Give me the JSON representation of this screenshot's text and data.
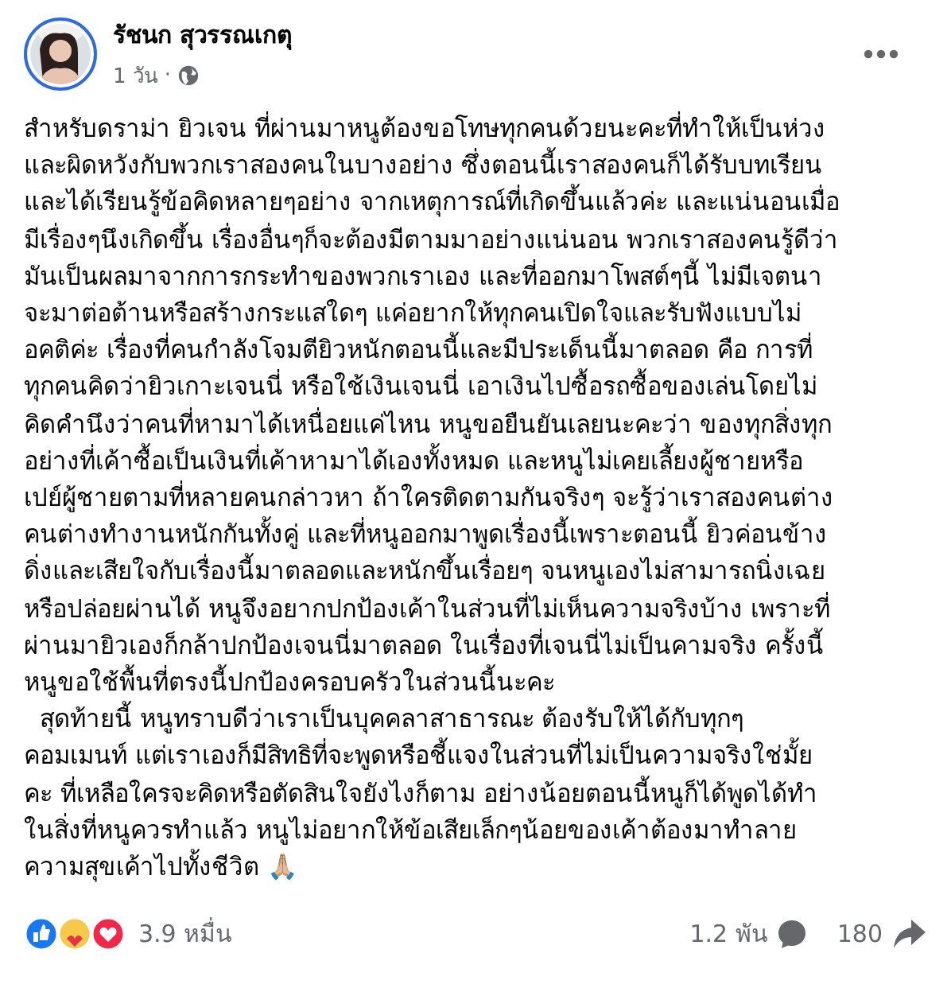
{
  "post": {
    "author": "รัชนก สุวรรณเกตุ",
    "time": "1 วัน",
    "separator": "·",
    "paragraphs": [
      {
        "lines": [
          "สำหรับดราม่า ยิวเจน ที่ผ่านมาหนูต้องขอโทษทุกคนด้วยนะคะที่ทำให้เป็นห่วง",
          "และผิดหวังกับพวกเราสองคนในบางอย่าง ซึ่งตอนนี้เราสองคนก็ได้รับบทเรียน",
          "และได้เรียนรู้ข้อคิดหลายๆอย่าง จากเหตุการณ์ที่เกิดขึ้นแล้วค่ะ และแน่นอนเมื่อ",
          "มีเรื่องๆนึงเกิดขึ้น เรื่องอื่นๆก็จะต้องมีตามมาอย่างแน่นอน พวกเราสองคนรู้ดีว่า",
          "มันเป็นผลมาจากการกระทำของพวกเราเอง และที่ออกมาโพสต์ๆนี้ ไม่มีเจตนา",
          "จะมาต่อต้านหรือสร้างกระแสใดๆ แค่อยากให้ทุกคนเปิดใจและรับฟังแบบไม่",
          "อคติค่ะ เรื่องที่คนกำลังโจมตียิวหนักตอนนี้และมีประเด็นนี้มาตลอด คือ การที่",
          "ทุกคนคิดว่ายิวเกาะเจนนี่ หรือใช้เงินเจนนี่ เอาเงินไปซื้อรถซื้อของเล่นโดยไม่",
          "คิดคำนึงว่าคนที่หามาได้เหนื่อยแค่ไหน หนูขอยืนยันเลยนะคะว่า ของทุกสิ่งทุก",
          "อย่างที่เค้าซื้อเป็นเงินที่เค้าหามาได้เองทั้งหมด และหนูไม่เคยเลี้ยงผู้ชายหรือ",
          "เปย์ผู้ชายตามที่หลายคนกล่าวหา ถ้าใครติดตามกันจริงๆ จะรู้ว่าเราสองคนต่าง",
          "คนต่างทำงานหนักกันทั้งคู่ และที่หนูออกมาพูดเรื่องนี้เพราะตอนนี้ ยิวค่อนข้าง",
          "ดิ่งและเสียใจกับเรื่องนี้มาตลอดและหนักขึ้นเรื่อยๆ จนหนูเองไม่สามารถนิ่งเฉย",
          "หรือปล่อยผ่านได้ หนูจึงอยากปกป้องเค้าในส่วนที่ไม่เห็นความจริงบ้าง เพราะที่",
          "ผ่านมายิวเองก็กล้าปกป้องเจนนี่มาตลอด ในเรื่องที่เจนนี่ไม่เป็นคามจริง ครั้งนี้",
          "หนูขอใช้พื้นที่ตรงนี้ปกป้องครอบครัวในส่วนนี้นะคะ"
        ]
      },
      {
        "lines": [
          "  สุดท้ายนี้ หนูทราบดีว่าเราเป็นบุคคลาสาธารณะ ต้องรับให้ได้กับทุกๆ",
          "คอมเมนท์ แต่เราเองก็มีสิทธิที่จะพูดหรือชี้แจงในส่วนที่ไม่เป็นความจริงใช่มั้ย",
          "คะ ที่เหลือใครจะคิดหรือตัดสินใจยังไงก็ตาม อย่างน้อยตอนนี้หนูก็ได้พูดได้ทำ",
          "ในสิ่งที่หนูควรทำแล้ว หนูไม่อยากให้ข้อเสียเล็กๆน้อยของเค้าต้องมาทำลาย",
          "ความสุขเค้าไปทั้งชีวิต 🙏🏼"
        ]
      }
    ],
    "reactions": {
      "count": "3.9 หมื่น"
    },
    "comments": {
      "count": "1.2 พัน"
    },
    "shares": {
      "count": "180"
    }
  }
}
